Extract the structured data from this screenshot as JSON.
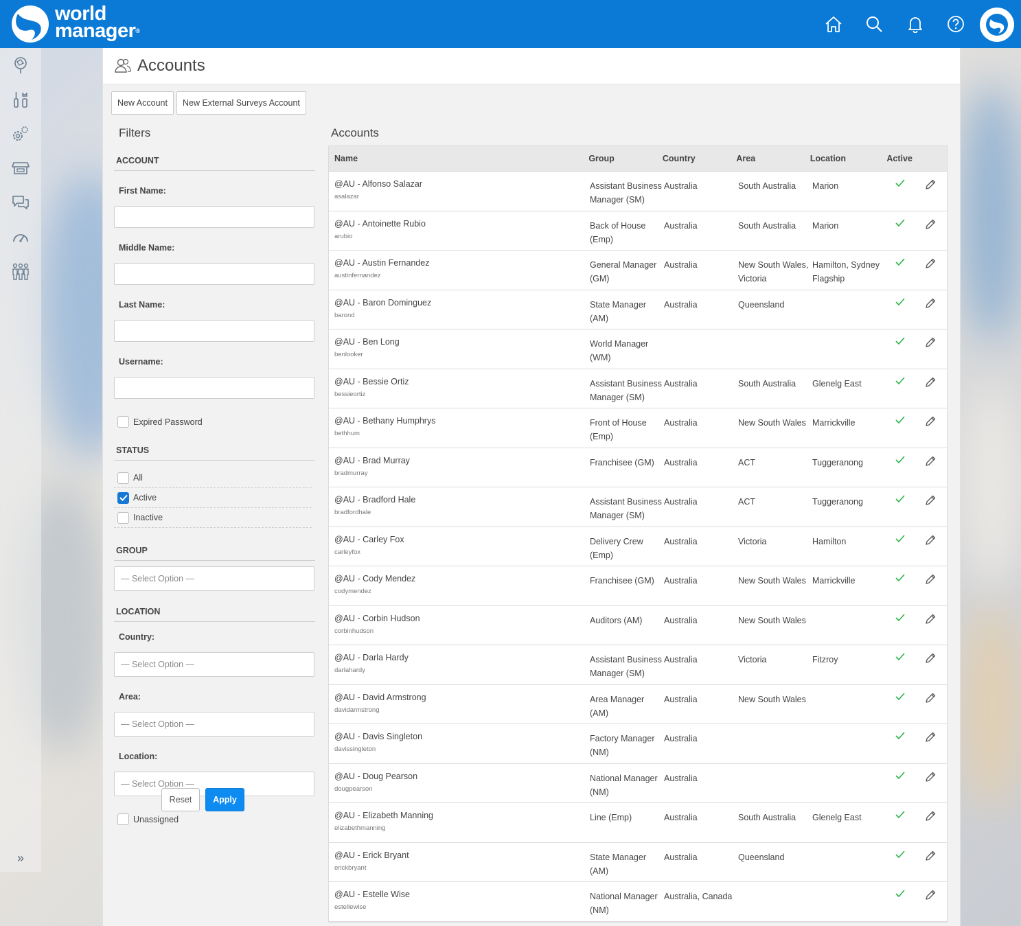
{
  "header": {
    "brand_line1": "world",
    "brand_line2": "manager",
    "registered": "®",
    "icons": [
      "home-icon",
      "search-icon",
      "bell-icon",
      "help-icon"
    ]
  },
  "sidebar": {
    "icons": [
      "map-pin-icon",
      "tools-icon",
      "settings-icon",
      "store-icon",
      "chat-icon",
      "speedometer-icon",
      "people-icon"
    ],
    "expand": "»"
  },
  "page": {
    "title": "Accounts",
    "new_account": "New Account",
    "new_external": "New External Surveys Account"
  },
  "filters": {
    "title": "Filters",
    "account_heading": "ACCOUNT",
    "first_name": "First Name:",
    "middle_name": "Middle Name:",
    "last_name": "Last Name:",
    "username": "Username:",
    "expired_password": "Expired Password",
    "status_heading": "STATUS",
    "status_all": "All",
    "status_active": "Active",
    "status_inactive": "Inactive",
    "group_heading": "GROUP",
    "select_placeholder": "— Select Option —",
    "location_heading": "LOCATION",
    "country": "Country:",
    "area": "Area:",
    "location": "Location:",
    "unassigned": "Unassigned",
    "reset": "Reset",
    "apply": "Apply"
  },
  "accounts": {
    "title": "Accounts",
    "columns": {
      "name": "Name",
      "group": "Group",
      "country": "Country",
      "area": "Area",
      "location": "Location",
      "active": "Active"
    },
    "rows": [
      {
        "name": "@AU - Alfonso Salazar",
        "user": "asalazar",
        "group": "Assistant Business Manager (SM)",
        "country": "Australia",
        "area": "South Australia",
        "location": "Marion"
      },
      {
        "name": "@AU - Antoinette Rubio",
        "user": "arubio",
        "group": "Back of House (Emp)",
        "country": "Australia",
        "area": "South Australia",
        "location": "Marion"
      },
      {
        "name": "@AU - Austin Fernandez",
        "user": "austinfernandez",
        "group": "General Manager (GM)",
        "country": "Australia",
        "area": "New South Wales, Victoria",
        "location": "Hamilton, Sydney Flagship"
      },
      {
        "name": "@AU - Baron Dominguez",
        "user": "barond",
        "group": "State Manager (AM)",
        "country": "Australia",
        "area": "Queensland",
        "location": ""
      },
      {
        "name": "@AU - Ben Long",
        "user": "benlooker",
        "group": "World Manager (WM)",
        "country": "",
        "area": "",
        "location": ""
      },
      {
        "name": "@AU - Bessie Ortiz",
        "user": "bessieortiz",
        "group": "Assistant Business Manager (SM)",
        "country": "Australia",
        "area": "South Australia",
        "location": "Glenelg East"
      },
      {
        "name": "@AU - Bethany Humphrys",
        "user": "bethhum",
        "group": "Front of House (Emp)",
        "country": "Australia",
        "area": "New South Wales",
        "location": "Marrickville"
      },
      {
        "name": "@AU - Brad Murray",
        "user": "bradmurray",
        "group": "Franchisee (GM)",
        "country": "Australia",
        "area": "ACT",
        "location": "Tuggeranong"
      },
      {
        "name": "@AU - Bradford Hale",
        "user": "bradfordhale",
        "group": "Assistant Business Manager (SM)",
        "country": "Australia",
        "area": "ACT",
        "location": "Tuggeranong"
      },
      {
        "name": "@AU - Carley Fox",
        "user": "carleyfox",
        "group": "Delivery Crew (Emp)",
        "country": "Australia",
        "area": "Victoria",
        "location": "Hamilton"
      },
      {
        "name": "@AU - Cody Mendez",
        "user": "codymendez",
        "group": "Franchisee (GM)",
        "country": "Australia",
        "area": "New South Wales",
        "location": "Marrickville"
      },
      {
        "name": "@AU - Corbin Hudson",
        "user": "corbinhudson",
        "group": "Auditors (AM)",
        "country": "Australia",
        "area": "New South Wales",
        "location": ""
      },
      {
        "name": "@AU - Darla Hardy",
        "user": "darlahardy",
        "group": "Assistant Business Manager (SM)",
        "country": "Australia",
        "area": "Victoria",
        "location": "Fitzroy"
      },
      {
        "name": "@AU - David Armstrong",
        "user": "davidarmstrong",
        "group": "Area Manager (AM)",
        "country": "Australia",
        "area": "New South Wales",
        "location": ""
      },
      {
        "name": "@AU - Davis Singleton",
        "user": "davissingleton",
        "group": "Factory Manager (NM)",
        "country": "Australia",
        "area": "",
        "location": ""
      },
      {
        "name": "@AU - Doug Pearson",
        "user": "dougpearson",
        "group": "National Manager (NM)",
        "country": "Australia",
        "area": "",
        "location": ""
      },
      {
        "name": "@AU - Elizabeth Manning",
        "user": "elizabethmanning",
        "group": "Line (Emp)",
        "country": "Australia",
        "area": "South Australia",
        "location": "Glenelg East"
      },
      {
        "name": "@AU - Erick Bryant",
        "user": "erickbryant",
        "group": "State Manager (AM)",
        "country": "Australia",
        "area": "Queensland",
        "location": ""
      },
      {
        "name": "@AU - Estelle Wise",
        "user": "estellewise",
        "group": "National Manager (NM)",
        "country": "Australia, Canada",
        "area": "",
        "location": ""
      }
    ]
  }
}
